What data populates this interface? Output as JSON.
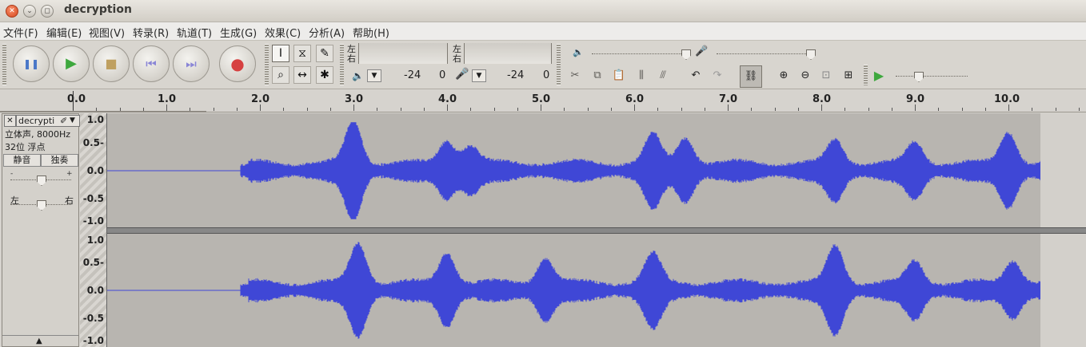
{
  "window": {
    "title": "decryption",
    "close_glyph": "✕",
    "min_glyph": "⌄",
    "max_glyph": "◻"
  },
  "menu": [
    "文件(F)",
    "编辑(E)",
    "视图(V)",
    "转录(R)",
    "轨道(T)",
    "生成(G)",
    "效果(C)",
    "分析(A)",
    "帮助(H)"
  ],
  "transport": {
    "pause_icon": "pause-icon",
    "play_icon": "play-icon",
    "stop_icon": "stop-icon",
    "skip_start_icon": "skip-start-icon",
    "skip_end_icon": "skip-end-icon",
    "record_icon": "record-icon",
    "glyphs": {
      "pause": "❚❚",
      "play": "▶",
      "stop": "■",
      "skip_start": "⏮",
      "skip_end": "⏭",
      "record": "●"
    },
    "colors": {
      "pause": "#4a78c8",
      "play": "#3ea83e",
      "stop": "#bfa060",
      "skip": "#8a86d6",
      "record": "#d64040"
    }
  },
  "tools": {
    "selection": "I",
    "envelope": "⧖",
    "draw": "✎",
    "zoom": "⌕",
    "timeshift": "↔",
    "multi": "✱"
  },
  "meters": {
    "play_left": "左",
    "play_right": "右",
    "rec_left": "左",
    "rec_right": "右",
    "play_scale": [
      "-24",
      "0"
    ],
    "rec_scale": [
      "-24",
      "0"
    ],
    "play_icon": "speaker-icon",
    "rec_icon": "microphone-icon"
  },
  "mixer": {
    "speaker": "🔈",
    "mic": "🎤"
  },
  "edit_buttons": {
    "undo": "↶",
    "redo": "↷",
    "sync_lock": "⛓",
    "zoom_in": "⊕",
    "zoom_out": "⊖",
    "fit_selection": "⊡",
    "fit_project": "⊞",
    "play_at_speed": "▶"
  },
  "ruler": {
    "labels": [
      "0.0",
      "1.0",
      "2.0",
      "3.0",
      "4.0",
      "5.0",
      "6.0",
      "7.0",
      "8.0",
      "9.0",
      "10.0"
    ]
  },
  "track": {
    "close": "✕",
    "name": "decrypti",
    "menu_glyph": "▼",
    "info_line1": "立体声, 8000Hz",
    "info_line2": "32位 浮点",
    "mute": "静音",
    "solo": "独奏",
    "gain_minus": "-",
    "gain_plus": "+",
    "pan_left": "左",
    "pan_right": "右",
    "collapse": "▲",
    "gain_level": 0.5,
    "pan_level": 0.5
  },
  "amplitude_labels": [
    "1.0",
    "0.5-",
    "0.0",
    "-0.5",
    "-1.0"
  ],
  "colors": {
    "waveform": "#3f47d6",
    "wave_bg": "#b8b5b0",
    "accent": "#3f47d6"
  },
  "audio": {
    "duration_s": 10.52,
    "silence_until_s": 1.8,
    "bursts_ch1": [
      [
        3.0,
        0.82
      ],
      [
        4.0,
        0.45
      ],
      [
        4.25,
        0.35
      ],
      [
        6.2,
        0.55
      ],
      [
        6.55,
        0.5
      ],
      [
        8.15,
        0.45
      ],
      [
        9.0,
        0.4
      ],
      [
        10.0,
        0.62
      ]
    ],
    "bursts_ch2": [
      [
        3.05,
        0.78
      ],
      [
        4.0,
        0.6
      ],
      [
        5.05,
        0.5
      ],
      [
        6.2,
        0.55
      ],
      [
        8.15,
        0.72
      ],
      [
        9.0,
        0.42
      ],
      [
        10.05,
        0.45
      ]
    ]
  }
}
